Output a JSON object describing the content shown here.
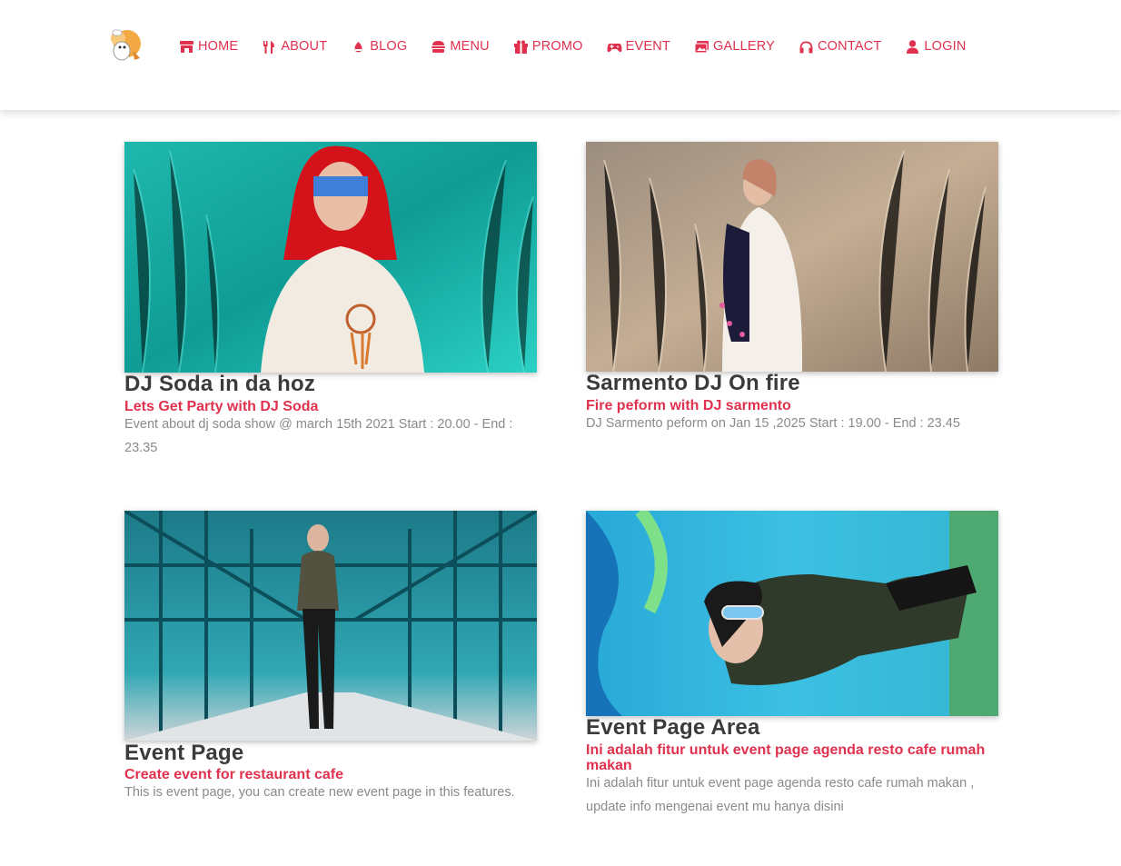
{
  "nav": {
    "items": [
      {
        "label": "HOME",
        "icon": "store-icon"
      },
      {
        "label": "ABOUT",
        "icon": "utensils-icon"
      },
      {
        "label": "BLOG",
        "icon": "blog-icon"
      },
      {
        "label": "MENU",
        "icon": "hamburger-icon"
      },
      {
        "label": "PROMO",
        "icon": "gift-icon"
      },
      {
        "label": "EVENT",
        "icon": "gamepad-icon"
      },
      {
        "label": "GALLERY",
        "icon": "images-icon"
      },
      {
        "label": "CONTACT",
        "icon": "headphones-icon"
      },
      {
        "label": "LOGIN",
        "icon": "user-icon"
      }
    ]
  },
  "events": [
    {
      "title": "DJ Soda in da hoz",
      "subtitle": "Lets Get Party with DJ Soda",
      "description": "Event about dj soda show @ march 15th 2021 Start : 20.00 - End : 23.35"
    },
    {
      "title": "Sarmento DJ On fire",
      "subtitle": "Fire peform with DJ sarmento",
      "description": "DJ Sarmento peform on Jan 15 ,2025 Start : 19.00 - End : 23.45"
    },
    {
      "title": "Event Page",
      "subtitle": "Create event for restaurant cafe",
      "description": "This is event page, you can create new event page in this features."
    },
    {
      "title": "Event Page Area",
      "subtitle": "Ini adalah fitur untuk event page agenda resto cafe rumah makan",
      "description": "Ini adalah fitur untuk event page agenda resto cafe rumah makan , update info mengenai event mu hanya disini"
    }
  ],
  "colors": {
    "accent": "#e0314e",
    "title": "#3b3b3b",
    "text": "#8a8a8a"
  }
}
